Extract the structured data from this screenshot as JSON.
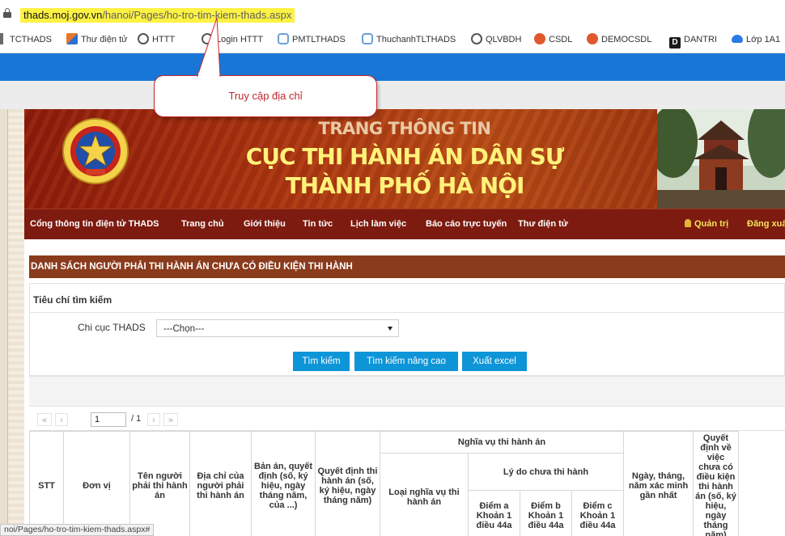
{
  "browser": {
    "url_host": "thads.moj.gov.vn",
    "url_path": "/hanoi/Pages/ho-tro-tim-kiem-thads.aspx",
    "bookmarks": [
      {
        "label": "TCTHADS",
        "icon": "folder-icon"
      },
      {
        "label": "Thư điện tử",
        "icon": "office-icon",
        "color": "#e9772a"
      },
      {
        "label": "HTTT",
        "icon": "globe-icon",
        "color": "#555555"
      },
      {
        "label": "Login HTTT",
        "icon": "globe-icon",
        "color": "#555555"
      },
      {
        "label": "PMTLTHADS",
        "icon": "app-icon",
        "color": "#6aa0d8"
      },
      {
        "label": "ThuchanhTLTHADS",
        "icon": "app-icon",
        "color": "#6aa0d8"
      },
      {
        "label": "QLVBDH",
        "icon": "globe-icon",
        "color": "#555555"
      },
      {
        "label": "CSDL",
        "icon": "dot-icon",
        "color": "#e0582d"
      },
      {
        "label": "DEMOCSDL",
        "icon": "dot-icon",
        "color": "#e0582d"
      },
      {
        "label": "DANTRI",
        "icon": "dantri-icon",
        "color": "#1a1a1a"
      },
      {
        "label": "Lớp 1A1",
        "icon": "cloud-icon",
        "color": "#2c7be5"
      }
    ],
    "status_url": "noi/Pages/ho-tro-tim-kiem-thads.aspx#"
  },
  "callout": {
    "text": "Truy cập địa chỉ"
  },
  "banner": {
    "line1": "TRANG THÔNG TIN",
    "line2": "CỤC THI HÀNH ÁN DÂN SỰ",
    "line3": "THÀNH PHỐ HÀ NỘI"
  },
  "nav": {
    "items": [
      "Cổng thông tin điện tử THADS",
      "Trang chủ",
      "Giới thiệu",
      "Tin tức",
      "Lịch làm việc",
      "Báo cáo trực tuyến",
      "Thư điện tử"
    ],
    "admin": "Quản trị",
    "logout": "Đăng xuất"
  },
  "page": {
    "title": "DANH SÁCH NGƯỜI PHẢI THI HÀNH ÁN CHƯA CÓ ĐIỀU KIỆN THI HÀNH",
    "criteria_label": "Tiêu chí tìm kiếm",
    "chicuc_label": "Chi cục THADS",
    "chicuc_value": "---Chọn---",
    "btn_search": "Tìm kiếm",
    "btn_advanced": "Tìm kiếm nâng cao",
    "btn_excel": "Xuất excel"
  },
  "pager": {
    "first": "«",
    "prev": "‹",
    "page": "1",
    "total": "/ 1",
    "next": "›",
    "last": "»"
  },
  "table": {
    "stt": "STT",
    "donvi": "Đơn vị",
    "ten": "Tên người phải thi hành án",
    "diachi": "Địa chỉ của người phải thi hành án",
    "banan": "Bản án, quyết định (số, ký hiệu, ngày tháng năm, của ...)",
    "quyetdinh": "Quyết định thi hành án (số, ký hiệu, ngày tháng năm)",
    "nghiavu": "Nghĩa vụ thi hành án",
    "loai": "Loại nghĩa vụ thi hành án",
    "lydo": "Lý do chưa thi hành",
    "diema": "Điểm a Khoản 1 điều 44a",
    "diemb": "Điểm b Khoản 1 điều 44a",
    "diemc": "Điểm c Khoản 1 điều 44a",
    "ngay": "Ngày, tháng, năm xác minh gần nhất",
    "qdviec": "Quyết định về việc chưa có điều kiện thi hành án (số, ký hiệu, ngày tháng năm)"
  }
}
